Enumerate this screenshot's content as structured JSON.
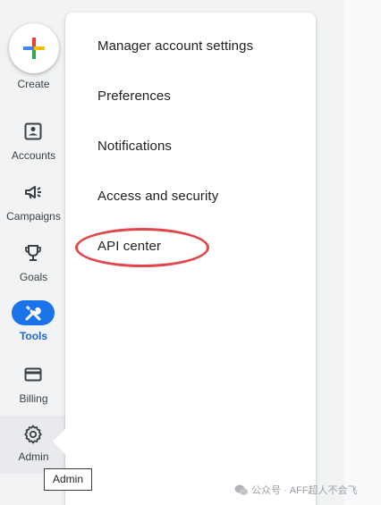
{
  "nav": {
    "create_label": "Create",
    "items": [
      {
        "label": "Accounts",
        "icon": "accounts-icon"
      },
      {
        "label": "Campaigns",
        "icon": "campaigns-icon"
      },
      {
        "label": "Goals",
        "icon": "goals-icon"
      },
      {
        "label": "Tools",
        "icon": "tools-icon",
        "active": true
      },
      {
        "label": "Billing",
        "icon": "billing-icon"
      },
      {
        "label": "Admin",
        "icon": "gear-icon",
        "selected": true
      }
    ]
  },
  "menu": {
    "items": [
      {
        "label": "Manager account settings"
      },
      {
        "label": "Preferences"
      },
      {
        "label": "Notifications"
      },
      {
        "label": "Access and security"
      },
      {
        "label": "API center",
        "highlighted": true
      }
    ]
  },
  "tooltip": {
    "text": "Admin"
  },
  "watermark": {
    "text": "公众号 · AFF超人不会飞"
  },
  "colors": {
    "accent": "#1a73e8",
    "highlight_ring": "#e0474c",
    "rail_bg": "#f1f3f4"
  }
}
